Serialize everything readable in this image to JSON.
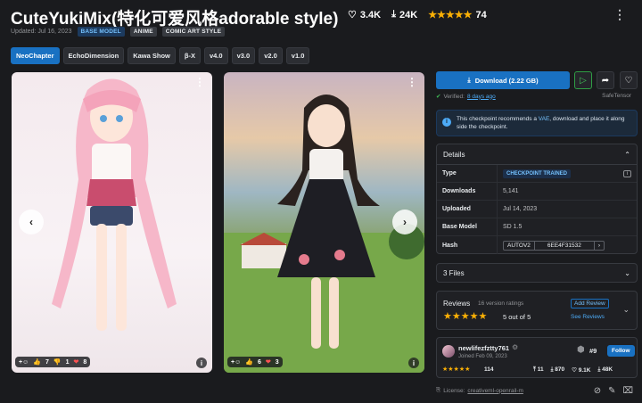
{
  "header": {
    "title": "CuteYukiMix(特化可爱风格adorable style)",
    "likes": "3.4K",
    "downloads": "24K",
    "rating_count": "74",
    "updated": "Updated: Jul 16, 2023",
    "badges": [
      "BASE MODEL",
      "ANIME",
      "COMIC ART STYLE"
    ]
  },
  "versions": [
    "NeoChapter",
    "EchoDimension",
    "Kawa Show",
    "β-X",
    "v4.0",
    "v3.0",
    "v2.0",
    "v1.0"
  ],
  "images": [
    {
      "reactions": {
        "thumbs_up": "7",
        "thumbs_down": "1",
        "heart": "8"
      }
    },
    {
      "reactions": {
        "thumbs_up": "6",
        "heart": "3"
      }
    }
  ],
  "download": {
    "label": "Download (2.22 GB)",
    "verified_label": "Verified:",
    "verified_link": "8 days ago",
    "safetensor": "SafeTensor"
  },
  "notice": {
    "pre": "This checkpoint recommends a ",
    "link": "VAE",
    "post": ", download and place it along side the checkpoint."
  },
  "details": {
    "title": "Details",
    "rows": [
      {
        "key": "Type",
        "value": "CHECKPOINT TRAINED"
      },
      {
        "key": "Downloads",
        "value": "5,141"
      },
      {
        "key": "Uploaded",
        "value": "Jul 14, 2023"
      },
      {
        "key": "Base Model",
        "value": "SD 1.5"
      },
      {
        "key": "Hash",
        "hash_type": "AUTOV2",
        "hash_value": "6EE4F31532"
      }
    ]
  },
  "files": {
    "label": "3 Files"
  },
  "reviews": {
    "title": "Reviews",
    "count": "16 version ratings",
    "score": "5 out of 5",
    "add_review": "Add Review",
    "see_reviews": "See Reviews"
  },
  "creator": {
    "name": "newlifezfztty761",
    "joined": "Joined Feb 09, 2023",
    "rank": "#9",
    "follow": "Follow",
    "rating_count": "114",
    "uploads": "11",
    "downloads": "870",
    "likes": "9.1K",
    "total": "48K"
  },
  "license": {
    "label": "License:",
    "link": "creativeml-openrail-m"
  }
}
